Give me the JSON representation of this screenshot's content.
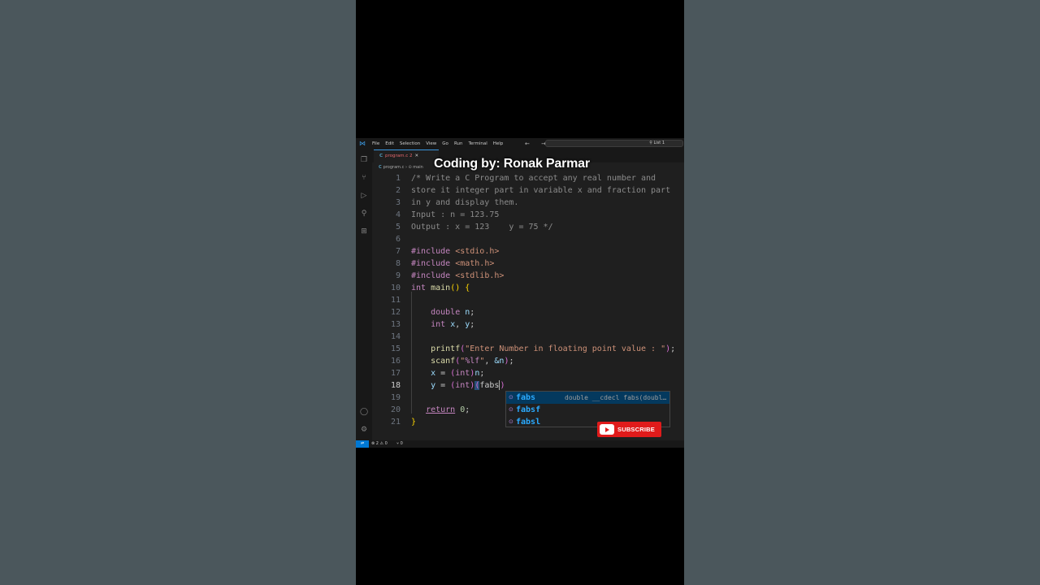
{
  "overlay": {
    "title": "Coding by: Ronak Parmar",
    "subscribe_label": "SUBSCRIBE"
  },
  "menubar": {
    "items": [
      "File",
      "Edit",
      "Selection",
      "View",
      "Go",
      "Run",
      "Terminal",
      "Help"
    ],
    "nav": "← →",
    "search_text": "⚲ List 1"
  },
  "tab": {
    "lang": "C",
    "label": "program.c 2",
    "close": "✕"
  },
  "breadcrumb": {
    "lang": "C",
    "text": "program.c › ⊙ main"
  },
  "code_lines": [
    {
      "n": "1"
    },
    {
      "n": "2"
    },
    {
      "n": "3"
    },
    {
      "n": "4"
    },
    {
      "n": "5"
    },
    {
      "n": "6"
    },
    {
      "n": "7"
    },
    {
      "n": "8"
    },
    {
      "n": "9"
    },
    {
      "n": "10"
    },
    {
      "n": "11"
    },
    {
      "n": "12"
    },
    {
      "n": "13"
    },
    {
      "n": "14"
    },
    {
      "n": "15"
    },
    {
      "n": "16"
    },
    {
      "n": "17"
    },
    {
      "n": "18"
    },
    {
      "n": "19"
    },
    {
      "n": "20"
    },
    {
      "n": "21"
    }
  ],
  "code": {
    "l1": "/* Write a C Program to accept any real number and",
    "l2": "store it integer part in variable x and fraction part",
    "l3": "in y and display them.",
    "l4": "Input : n = 123.75",
    "l5": "Output : x = 123    y = 75 */",
    "inc_kw": "#include",
    "h7": "<stdio.h>",
    "h8": "<math.h>",
    "h9": "<stdlib.h>",
    "int": "int",
    "main": "main",
    "double": "double",
    "n": "n",
    "x": "x",
    "y": "y",
    "printf": "printf",
    "printf_str": "\"Enter Number in floating point value : \"",
    "scanf": "scanf",
    "scanf_q1": "\"",
    "scanf_fmt": "%lf",
    "scanf_q2": "\"",
    "amp_n": "&n",
    "int_cast": "int",
    "typed": "fabs",
    "return": "return",
    "zero": "0"
  },
  "suggest": {
    "items": [
      {
        "icon": "⊙",
        "label": "fabs",
        "detail": "double __cdecl fabs(double _X)"
      },
      {
        "icon": "⊙",
        "label": "fabsf",
        "detail": ""
      },
      {
        "icon": "⊙",
        "label": "fabsl",
        "detail": ""
      }
    ]
  },
  "status": {
    "remote": "⇌",
    "problems": "⊗ 2 ⚠ 0",
    "ports": "⑂ 0"
  }
}
